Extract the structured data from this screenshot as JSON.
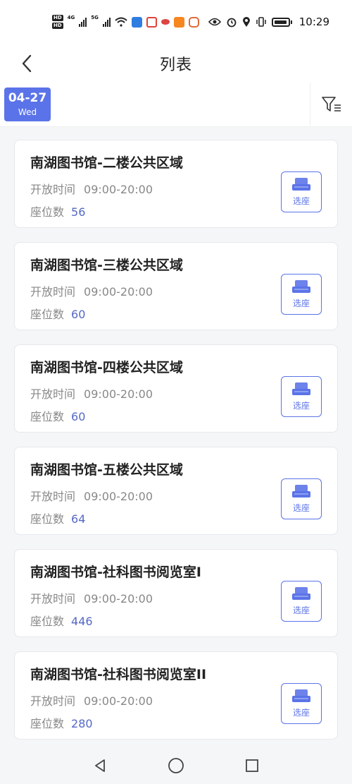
{
  "status_bar": {
    "hd_labels": [
      "HD",
      "HD"
    ],
    "network_1": "4G",
    "network_2": "5G",
    "time": "10:29"
  },
  "header": {
    "title": "列表"
  },
  "date": {
    "day": "04-27",
    "weekday": "Wed"
  },
  "colors": {
    "accent": "#5b73e8",
    "seat_number": "#5468c6"
  },
  "rooms": [
    {
      "name": "南湖图书馆-二楼公共区域",
      "hours_label": "开放时间",
      "hours": "09:00-20:00",
      "seats_label": "座位数",
      "seats": "56",
      "button_label": "选座"
    },
    {
      "name": "南湖图书馆-三楼公共区域",
      "hours_label": "开放时间",
      "hours": "09:00-20:00",
      "seats_label": "座位数",
      "seats": "60",
      "button_label": "选座"
    },
    {
      "name": "南湖图书馆-四楼公共区域",
      "hours_label": "开放时间",
      "hours": "09:00-20:00",
      "seats_label": "座位数",
      "seats": "60",
      "button_label": "选座"
    },
    {
      "name": "南湖图书馆-五楼公共区域",
      "hours_label": "开放时间",
      "hours": "09:00-20:00",
      "seats_label": "座位数",
      "seats": "64",
      "button_label": "选座"
    },
    {
      "name": "南湖图书馆-社科图书阅览室I",
      "hours_label": "开放时间",
      "hours": "09:00-20:00",
      "seats_label": "座位数",
      "seats": "446",
      "button_label": "选座"
    },
    {
      "name": "南湖图书馆-社科图书阅览室II",
      "hours_label": "开放时间",
      "hours": "09:00-20:00",
      "seats_label": "座位数",
      "seats": "280",
      "button_label": "选座"
    }
  ]
}
